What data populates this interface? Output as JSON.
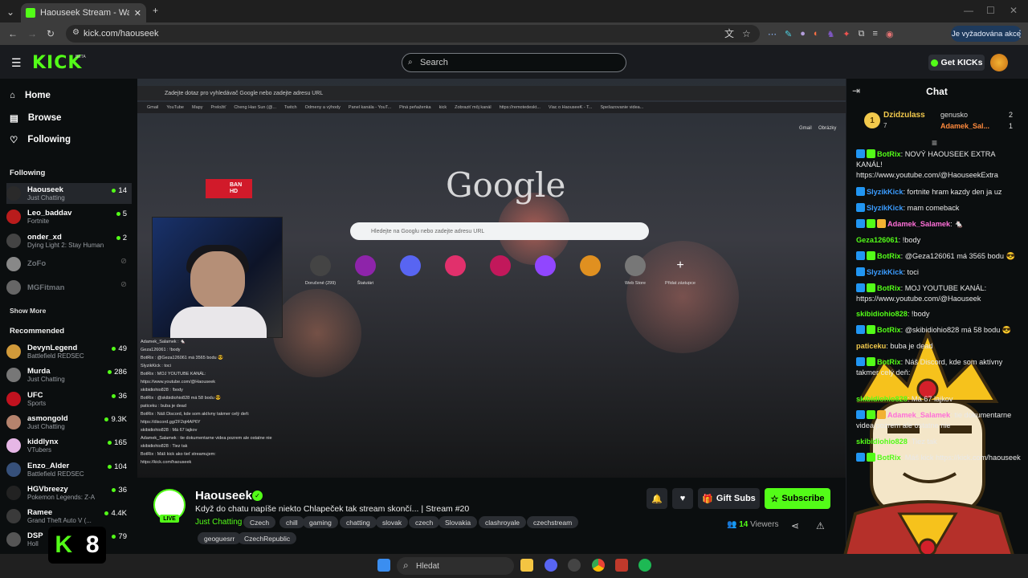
{
  "browser": {
    "tab_title": "Haouseek Stream - Watch Live",
    "url": "kick.com/haouseek",
    "action_label": "Je vyžadována akce"
  },
  "header": {
    "logo": "KICK",
    "beta": "BETA",
    "search_placeholder": "Search",
    "get_kicks": "Get KICKs"
  },
  "nav": [
    {
      "label": "Home",
      "icon": "home-icon"
    },
    {
      "label": "Browse",
      "icon": "browse-icon"
    },
    {
      "label": "Following",
      "icon": "heart-icon"
    }
  ],
  "following_title": "Following",
  "following": [
    {
      "name": "Haouseek",
      "category": "Just Chatting",
      "viewers": "14",
      "color": "#2a2a2a"
    },
    {
      "name": "Leo_baddav",
      "category": "Fortnite",
      "viewers": "5",
      "color": "#b91c1c"
    },
    {
      "name": "onder_xd",
      "category": "Dying Light 2: Stay Human",
      "viewers": "2",
      "color": "#444"
    },
    {
      "name": "ZoFo",
      "category": "",
      "viewers": "",
      "color": "#888"
    },
    {
      "name": "MGFitman",
      "category": "",
      "viewers": "",
      "color": "#666"
    }
  ],
  "show_more": "Show More",
  "recommended_title": "Recommended",
  "recommended": [
    {
      "name": "DevynLegend",
      "category": "Battlefield REDSEC",
      "viewers": "49",
      "color": "#d19a3a"
    },
    {
      "name": "Murda",
      "category": "Just Chatting",
      "viewers": "286",
      "color": "#777"
    },
    {
      "name": "UFC",
      "category": "Sports",
      "viewers": "36",
      "color": "#c1121f"
    },
    {
      "name": "asmongold",
      "category": "Just Chatting",
      "viewers": "9.3K",
      "color": "#b5836d"
    },
    {
      "name": "kiddlynx",
      "category": "VTubers",
      "viewers": "165",
      "color": "#e6b7e6"
    },
    {
      "name": "Enzo_Alder",
      "category": "Battlefield REDSEC",
      "viewers": "104",
      "color": "#36507a"
    },
    {
      "name": "HGVbreezy",
      "category": "Pokemon Legends: Z-A",
      "viewers": "36",
      "color": "#222"
    },
    {
      "name": "Ramee",
      "category": "Grand Theft Auto V (...",
      "viewers": "4.4K",
      "color": "#3a3a3a"
    },
    {
      "name": "DSP",
      "category": "Holl",
      "viewers": "79",
      "color": "#555"
    }
  ],
  "player": {
    "inner_url": "Zadejte dotaz pro vyhledávač Google nebo zadejte adresu URL",
    "bookmarks": [
      "Gmail",
      "YouTube",
      "Mapy",
      "Preložiť",
      "Cheng Hao Sun (@...",
      "Twitch",
      "Odmeny a výhody",
      "Panel kanála - YouT...",
      "Piná peňaženka",
      "kick",
      "Zobraziť môj kanál",
      "https://remotedeskt...",
      "Viac o HaouseeK - T...",
      "Spešazovanie videa..."
    ],
    "google_logo": "Google",
    "google_search": "Hledejte na Googlu nebo zadejte adresu URL",
    "gmail": "Gmail",
    "images": "Obrázky",
    "shortcuts": [
      "Doručené (299)",
      "Štatutári",
      "",
      "",
      "",
      "",
      "",
      "Web Store",
      "Přidat zástupce"
    ],
    "mini_chat": [
      "Adamek_Salamek : 🐁",
      "Geza126061 : !body",
      "BotRix : @Geza126061 má 3565 bodu 😎",
      "SlyzikKick : toci",
      "BotRix : MOJ YOUTUBE KANÁL:",
      "https://www.youtube.com/@Haouseek",
      "skibidiohio828 : !body",
      "BotRix : @skibidiohio828 má 58 bodu 😎",
      "paticeku : buba je dead",
      "BotRix : Náš Discord, kde som aktívny takmer celý deň:",
      "https://discord.gg/2F2qt4AP6Y",
      "skibidiohio828 : Má 67 lajkov",
      "Adamek_Salamek : tie dokumentarne videa pozrem ale ostatne nie",
      "skibidiohio828 : Tiez tak",
      "BotRix : Máš kick ako tieť streamujem:",
      "https://kick.com/haouseek"
    ]
  },
  "stream": {
    "channel": "Haouseek",
    "live": "LIVE",
    "title": "Když do chatu napíše niekto Chlapeček tak stream skončí... | Stream #20",
    "category": "Just Chatting",
    "tags": [
      "Czech",
      "chill",
      "gaming",
      "chatting",
      "slovak",
      "czech",
      "Slovakia",
      "clashroyale",
      "czechstream",
      "geoguesrr",
      "CzechRepublic"
    ],
    "gift_subs": "Gift Subs",
    "subscribe": "Subscribe",
    "viewers": "14",
    "viewers_label": "Viewers"
  },
  "chat": {
    "title": "Chat",
    "leaderboard": {
      "rank": "1",
      "top": "Dzidzulass",
      "top_count": "7",
      "list": [
        {
          "name": "genusko",
          "count": "2"
        },
        {
          "name": "Adamek_Sal...",
          "count": "1"
        }
      ]
    },
    "messages": [
      {
        "user": "BotRix",
        "color": "#53fc18",
        "text": ": NOVÝ HAOUSEEK EXTRA KANÁL! https://www.youtube.com/@HaouseekExtra",
        "badges": 2
      },
      {
        "user": "SlyzikKick",
        "color": "#3b9cff",
        "text": ": fortnite hram kazdy den ja uz",
        "badges": 1
      },
      {
        "user": "SlyzikKick",
        "color": "#3b9cff",
        "text": ": mam comeback",
        "badges": 1
      },
      {
        "user": "Adamek_Salamek",
        "color": "#ff6fd8",
        "text": ": 🐁",
        "badges": 3
      },
      {
        "user": "Geza126061",
        "color": "#53fc18",
        "text": ": !body",
        "badges": 0
      },
      {
        "user": "BotRix",
        "color": "#53fc18",
        "text": ": @Geza126061 má 3565 bodu 😎",
        "badges": 2
      },
      {
        "user": "SlyzikKick",
        "color": "#3b9cff",
        "text": ": toci",
        "badges": 1
      },
      {
        "user": "BotRix",
        "color": "#53fc18",
        "text": ": MOJ YOUTUBE KANÁL: https://www.youtube.com/@Haouseek",
        "badges": 2
      },
      {
        "user": "skibidiohio828",
        "color": "#53fc18",
        "text": ": !body",
        "badges": 0
      },
      {
        "user": "BotRix",
        "color": "#53fc18",
        "text": ": @skibidiohio828 má 58 bodu 😎",
        "badges": 2
      },
      {
        "user": "paticeku",
        "color": "#f2c94c",
        "text": ": buba je dead",
        "badges": 0
      },
      {
        "user": "BotRix",
        "color": "#53fc18",
        "text": ": Náš Discord, kde som aktívny takmer celý deň:",
        "badges": 2
      },
      {
        "user": "skibidiohio828",
        "color": "#53fc18",
        "text": ": Má 67 lajkov",
        "badges": 0
      },
      {
        "user": "Adamek_Salamek",
        "color": "#ff6fd8",
        "text": ": tie dokumentarne videa pozrem ale ostatne nie",
        "badges": 3
      },
      {
        "user": "skibidiohio828",
        "color": "#53fc18",
        "text": ": Tiez tak",
        "badges": 0
      },
      {
        "user": "BotRix",
        "color": "#53fc18",
        "text": ": Máš kick https://kick.com/haouseek",
        "badges": 2
      }
    ]
  },
  "taskbar": {
    "search": "Hledat"
  },
  "overlay": {
    "k8": "8"
  },
  "colors": {
    "accent": "#53fc18",
    "bg": "#0b0e0f",
    "panel": "#191b1f"
  }
}
